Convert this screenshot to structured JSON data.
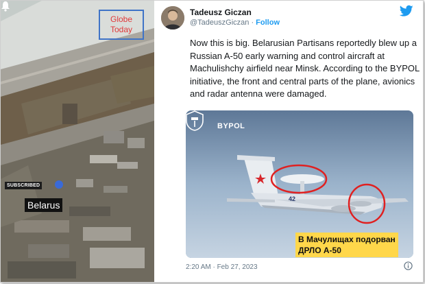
{
  "satellite": {
    "watermark_line1": "Globe",
    "watermark_line2": "Today",
    "subscribed_label": "SUBSCRIBED",
    "location_label": "Belarus"
  },
  "tweet": {
    "author_name": "Tadeusz Giczan",
    "author_handle": "@TadeuszGiczan",
    "separator": "·",
    "follow_label": "Follow",
    "body": "Now this is big. Belarusian Partisans reportedly blew up a Russian A-50 early warning and control aircraft at Machulishchy airfield near Minsk. According to the BYPOL initiative, the front and central parts of the plane, avionics and radar antenna were damaged.",
    "timestamp": "2:20 AM · Feb 27, 2023"
  },
  "media": {
    "brand": "BYPOL",
    "caption_line1": "В Мачулищах подорван",
    "caption_line2": "ДРЛО А-50",
    "aircraft_marking": "42"
  },
  "colors": {
    "twitter_blue": "#1d9bf0",
    "caption_yellow": "#ffd74a",
    "highlight_red": "#e02020",
    "watermark_red": "#e0393a",
    "watermark_border": "#3f73c7"
  }
}
